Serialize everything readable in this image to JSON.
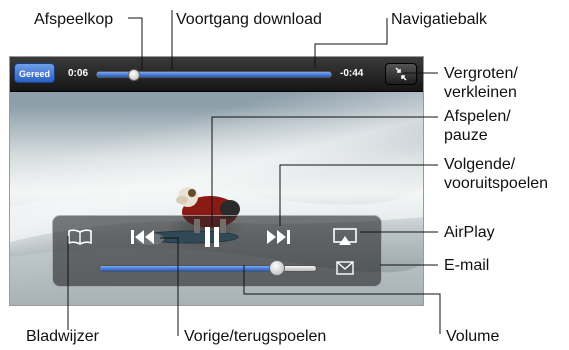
{
  "labels": {
    "afspeelkop": "Afspeelkop",
    "voortgang": "Voortgang download",
    "navigatiebalk": "Navigatiebalk",
    "vergroten": "Vergroten/\nverkleinen",
    "afspelen": "Afspelen/\npauze",
    "volgende": "Volgende/\nvooruitspoelen",
    "airplay": "AirPlay",
    "email": "E-mail",
    "bladwijzer": "Bladwijzer",
    "vorige": "Vorige/terugspoelen",
    "volume": "Volume"
  },
  "player": {
    "done_label": "Gereed",
    "elapsed": "0:06",
    "remaining": "-0:44",
    "playhead_fraction": 0.16,
    "download_fraction": 1.0,
    "volume_fraction": 0.82
  },
  "icons": {
    "bookmark": "bookmark-icon",
    "previous": "rewind-icon",
    "pause": "pause-icon",
    "next": "fast-forward-icon",
    "airplay": "airplay-icon",
    "email": "envelope-icon",
    "zoom": "zoom-toggle-icon"
  },
  "colors": {
    "accent_blue": "#2a5fc4",
    "hud_background": "#28282a"
  }
}
